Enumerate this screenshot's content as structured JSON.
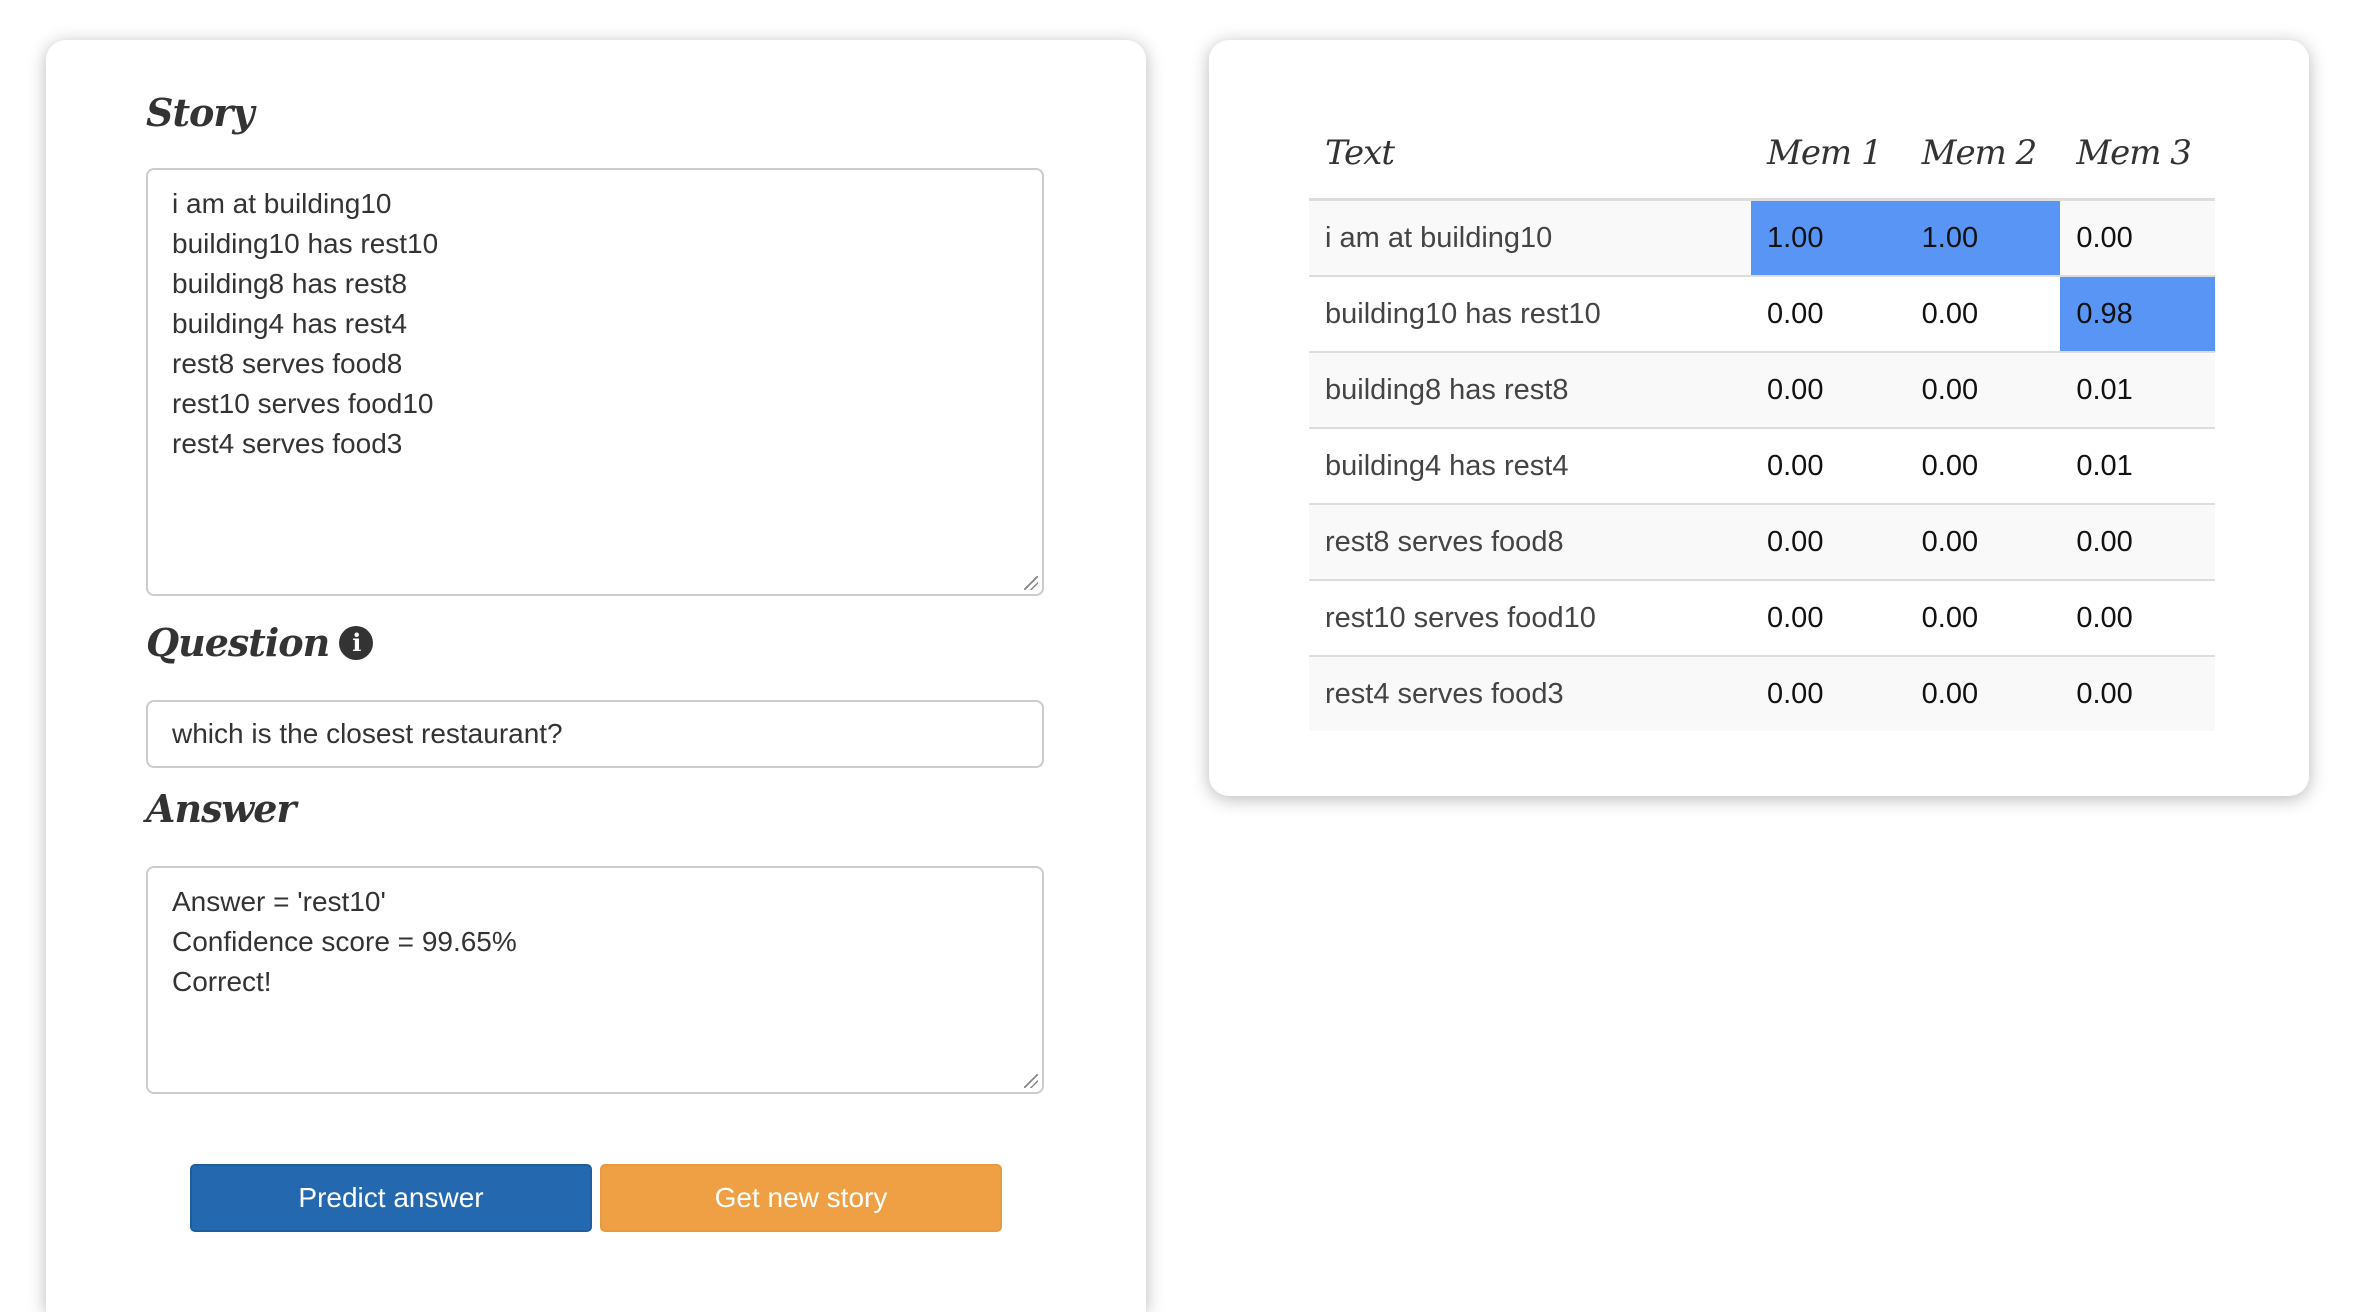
{
  "story": {
    "label": "Story",
    "lines": [
      "i am at building10",
      "building10 has rest10",
      "building8 has rest8",
      "building4 has rest4",
      "rest8 serves food8",
      "rest10 serves food10",
      "rest4 serves food3"
    ]
  },
  "question": {
    "label": "Question",
    "info_icon": "info-circle-icon",
    "value": "which is the closest restaurant?"
  },
  "answer": {
    "label": "Answer",
    "lines": [
      "Answer = 'rest10'",
      "Confidence score = 99.65%",
      "Correct!"
    ]
  },
  "buttons": {
    "predict": "Predict answer",
    "new_story": "Get new story",
    "predict_color": "#2469b0",
    "new_story_color": "#f0a044"
  },
  "memory_table": {
    "headers": [
      "Text",
      "Mem 1",
      "Mem 2",
      "Mem 3"
    ],
    "highlight_color": "#5895f5",
    "rows": [
      {
        "text": "i am at building10",
        "mem": [
          "1.00",
          "1.00",
          "0.00"
        ],
        "highlight": [
          true,
          true,
          false
        ]
      },
      {
        "text": "building10 has rest10",
        "mem": [
          "0.00",
          "0.00",
          "0.98"
        ],
        "highlight": [
          false,
          false,
          true
        ]
      },
      {
        "text": "building8 has rest8",
        "mem": [
          "0.00",
          "0.00",
          "0.01"
        ],
        "highlight": [
          false,
          false,
          false
        ]
      },
      {
        "text": "building4 has rest4",
        "mem": [
          "0.00",
          "0.00",
          "0.01"
        ],
        "highlight": [
          false,
          false,
          false
        ]
      },
      {
        "text": "rest8 serves food8",
        "mem": [
          "0.00",
          "0.00",
          "0.00"
        ],
        "highlight": [
          false,
          false,
          false
        ]
      },
      {
        "text": "rest10 serves food10",
        "mem": [
          "0.00",
          "0.00",
          "0.00"
        ],
        "highlight": [
          false,
          false,
          false
        ]
      },
      {
        "text": "rest4 serves food3",
        "mem": [
          "0.00",
          "0.00",
          "0.00"
        ],
        "highlight": [
          false,
          false,
          false
        ]
      }
    ]
  }
}
